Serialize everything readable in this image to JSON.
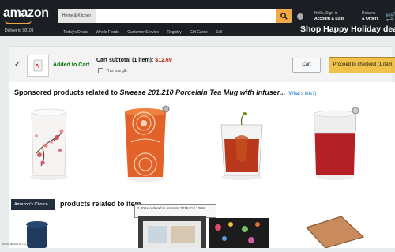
{
  "header": {
    "logo": "amazon",
    "deliver_to": "Deliver to 98109",
    "search_category": "Home & Kitchen",
    "account_line1": "Hello, Sign in",
    "account_line2": "Account & Lists",
    "orders_line1": "Returns",
    "orders_line2": "& Orders",
    "promo": "Shop Happy Holiday deals",
    "nav_items": [
      "Today's Deals",
      "Whole Foods",
      "Customer Service",
      "Registry",
      "Gift Cards",
      "Sell"
    ]
  },
  "cart_bar": {
    "added_text": "Added to Cart",
    "subtotal_label": "Cart subtotal (1 item):",
    "subtotal_price": "$12.69",
    "gift_label": "This is a gift",
    "cart_button": "Cart",
    "checkout_button": "Proceed to checkout (1 item)"
  },
  "sponsored": {
    "prefix": "Sponsored products related to ",
    "product_name": "Sweese 201.210 Porcelain Tea Mug with Infuser...",
    "whats_this": "(What's this?)"
  },
  "related": {
    "badge": "Amazon's Choice",
    "title": "products related to item",
    "tooltip": "1,000+ ordered in Amazon 2019 #1 / 120%"
  },
  "status_url": "www.amazon.com",
  "colors": {
    "header_bg": "#1b1f24",
    "search_button": "#f3a847",
    "checkout_button": "#f0c14b",
    "price": "#b12704",
    "added": "#007600",
    "link": "#0066c0"
  }
}
